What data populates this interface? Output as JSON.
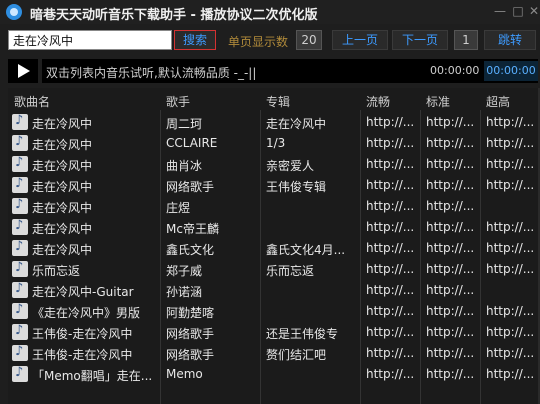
{
  "window": {
    "title": "暗巷天天动听音乐下载助手 - 播放协议二次优化版",
    "min_symbol": "—",
    "max_symbol": "□",
    "close_symbol": "✕"
  },
  "toolbar": {
    "search_value": "走在冷风中",
    "search_button": "搜索",
    "per_page_label": "单页显示数",
    "per_page_value": "20",
    "prev_label": "上一页",
    "next_label": "下一页",
    "page_value": "1",
    "jump_label": "跳转"
  },
  "player": {
    "status": "双击列表内音乐试听,默认流畅品质 -_-||",
    "current_time": "00:00:00",
    "total_time": "00:00:00"
  },
  "table": {
    "headers": [
      "歌曲名",
      "歌手",
      "专辑",
      "流畅",
      "标准",
      "超高"
    ],
    "rows": [
      [
        "走在冷风中",
        "周二珂",
        "走在冷风中",
        "http://...",
        "http://...",
        "http://..."
      ],
      [
        "走在冷风中",
        "CCLAIRE",
        "1/3",
        "http://...",
        "http://...",
        "http://..."
      ],
      [
        "走在冷风中",
        "曲肖冰",
        "亲密爱人",
        "http://...",
        "http://...",
        "http://..."
      ],
      [
        "走在冷风中",
        "网络歌手",
        "王伟俊专辑",
        "http://...",
        "http://...",
        "http://..."
      ],
      [
        "走在冷风中",
        "庄煜",
        "",
        "http://...",
        "http://...",
        ""
      ],
      [
        "走在冷风中",
        "Mc帝王麟",
        "",
        "http://...",
        "http://...",
        "http://..."
      ],
      [
        "走在冷风中",
        "鑫氏文化",
        "鑫氏文化4月...",
        "http://...",
        "http://...",
        "http://..."
      ],
      [
        "乐而忘返",
        "郑子威",
        "乐而忘返",
        "http://...",
        "http://...",
        "http://..."
      ],
      [
        "走在冷风中-Guitar",
        "孙诺涵",
        "",
        "http://...",
        "http://...",
        ""
      ],
      [
        "《走在冷风中》男版",
        "阿勤楚喀",
        "",
        "http://...",
        "http://...",
        "http://..."
      ],
      [
        "王伟俊-走在冷风中",
        "网络歌手",
        "还是王伟俊专",
        "http://...",
        "http://...",
        "http://..."
      ],
      [
        "王伟俊-走在冷风中",
        "网络歌手",
        "赘们结汇吧",
        "http://...",
        "http://...",
        "http://..."
      ],
      [
        "「Memo翻唱」走在...",
        "Memo",
        "",
        "http://...",
        "http://...",
        "http://..."
      ]
    ]
  }
}
